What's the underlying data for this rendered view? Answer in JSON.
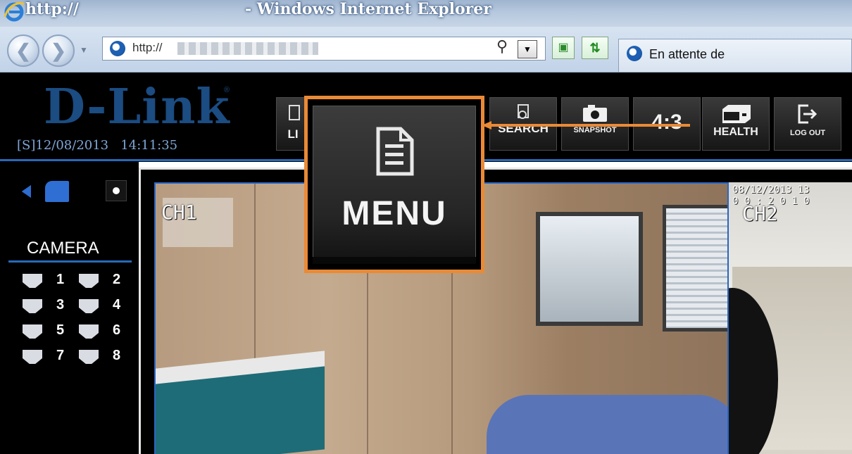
{
  "window": {
    "title_url": "http://",
    "title_app": "- Windows Internet Explorer"
  },
  "toolbar": {
    "address_prefix": "http://",
    "tab_title": "En attente de"
  },
  "dvr": {
    "logo": "D-Link",
    "logo_mark": "®",
    "datetime": "[S]12/08/2013   14:11:35",
    "buttons": {
      "live": "LI",
      "search": "SEARCH",
      "snapshot": "SNAPSHOT",
      "ratio": "4:3",
      "health": "HEALTH",
      "logout": "LOG OUT"
    },
    "highlight": {
      "label": "MENU"
    }
  },
  "sidebar": {
    "camera_title": "CAMERA",
    "cameras": [
      "1",
      "2",
      "3",
      "4",
      "5",
      "6",
      "7",
      "8"
    ]
  },
  "video": {
    "ch1_label": "CH1",
    "ch2_label": "CH2",
    "ch2_timestamp": "08/12/2013 13\n0 0 : 2 0 1 0"
  },
  "colors": {
    "accent_blue": "#2769b8",
    "highlight_orange": "#ea8a36",
    "logo_blue": "#1b4c82"
  }
}
